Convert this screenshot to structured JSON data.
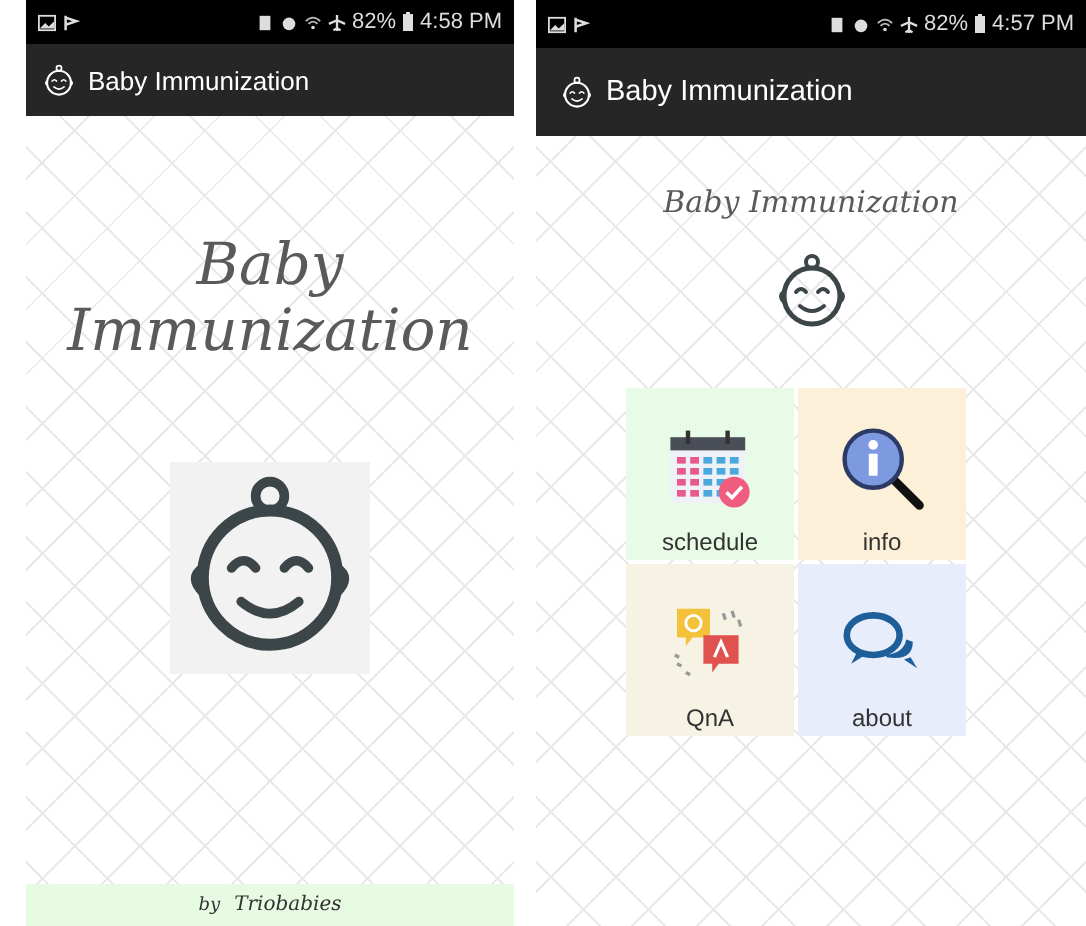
{
  "screens": [
    {
      "kind": "splash",
      "status_bar": {
        "battery": "82%",
        "time": "4:58 PM"
      },
      "app_bar": {
        "title": "Baby Immunization"
      },
      "heading_lines": [
        "Baby",
        "Immunization"
      ],
      "footer": {
        "prefix": "by",
        "name": "Triobabies"
      }
    },
    {
      "kind": "menu",
      "status_bar": {
        "battery": "82%",
        "time": "4:57 PM"
      },
      "app_bar": {
        "title": "Baby Immunization"
      },
      "heading_lines": [
        "Baby Immunization"
      ],
      "tiles": [
        {
          "label": "schedule",
          "color": "#e8fbe6"
        },
        {
          "label": "info",
          "color": "#fdf0d9"
        },
        {
          "label": "QnA",
          "color": "#f6f3e4"
        },
        {
          "label": "about",
          "color": "#e8edfb"
        }
      ]
    }
  ]
}
